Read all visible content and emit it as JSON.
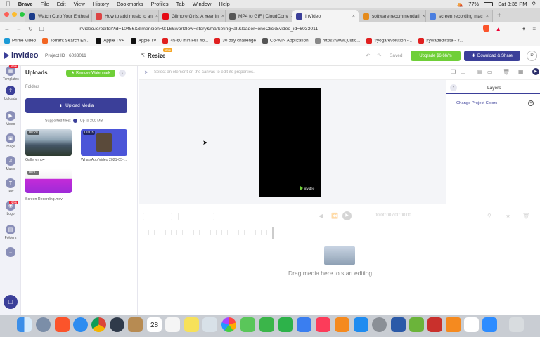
{
  "macbar": {
    "app": "Brave",
    "menus": [
      "File",
      "Edit",
      "View",
      "History",
      "Bookmarks",
      "Profiles",
      "Tab",
      "Window",
      "Help"
    ],
    "battery": "77%",
    "clock": "Sat 3:35 PM"
  },
  "tabs": [
    {
      "label": "Watch Curb Your Enthusi",
      "color": "#1a3b8a"
    },
    {
      "label": "How to add music to an",
      "color": "#d44"
    },
    {
      "label": "Gilmore Girls: A Year in",
      "color": "#e50914"
    },
    {
      "label": "MP4 to GIF | CloudConv",
      "color": "#555"
    },
    {
      "label": "InVideo",
      "color": "#3b3f99",
      "active": true
    },
    {
      "label": "software recommendati",
      "color": "#e58a1a"
    },
    {
      "label": "screen recording mac",
      "color": "#4a7ee0"
    }
  ],
  "address": {
    "url": "invideo.io/editor?id=10456&dimension=9:16&workflow=story&marketing=all&loader=oneClick&video_id=6033011"
  },
  "bookmarks": [
    {
      "label": "Prime Video",
      "color": "#1b9ad6"
    },
    {
      "label": "Torrent Search En...",
      "color": "#f26522"
    },
    {
      "label": "Apple TV+",
      "color": "#111"
    },
    {
      "label": "Apple TV",
      "color": "#111"
    },
    {
      "label": "45-60 min Full Yo...",
      "color": "#e02020"
    },
    {
      "label": "30 day challenge",
      "color": "#e02020"
    },
    {
      "label": "Co-WIN Application",
      "color": "#555"
    },
    {
      "label": "https://www.justlo...",
      "color": "#888"
    },
    {
      "label": "#yogarevolution -...",
      "color": "#e02020"
    },
    {
      "label": "#ywadedicate - Y...",
      "color": "#e02020"
    }
  ],
  "header": {
    "brand": "invideo",
    "project": "Project ID : 6033011",
    "resize": "Resize",
    "new_badge": "New",
    "saved": "Saved",
    "upgrade": "Upgrade $6.66/m",
    "download": "Download & Share",
    "avatar": "D"
  },
  "nav": [
    {
      "label": "Templates",
      "badge": "New"
    },
    {
      "label": "Uploads"
    },
    {
      "label": "Video"
    },
    {
      "label": "Image"
    },
    {
      "label": "Music"
    },
    {
      "label": "Text"
    },
    {
      "label": "Logo",
      "badge": "New"
    },
    {
      "label": "Folders"
    },
    {
      "label": ""
    }
  ],
  "uploads": {
    "title": "Uploads",
    "watermark": "Remove Watermark",
    "folders": "Folders :",
    "upload_btn": "Upload Media",
    "supported": "Supported files:",
    "limit": "Up to 200 MB",
    "items": [
      {
        "name": "Gallery.mp4",
        "duration": "00:20"
      },
      {
        "name": "WhatsApp Video 2021-05-...",
        "duration": "00:03"
      },
      {
        "name": "Screen Recording.mov",
        "duration": "00:17"
      }
    ]
  },
  "toolbar": {
    "hint": "Select an element on the canvas to edit its properties."
  },
  "canvas": {
    "watermark": "invideo"
  },
  "layers": {
    "title": "Layers",
    "change_colors": "Change Project Colors"
  },
  "timeline": {
    "drag": "Drag media here to start editing",
    "timecode": "00:00:00 / 00:00:00"
  }
}
